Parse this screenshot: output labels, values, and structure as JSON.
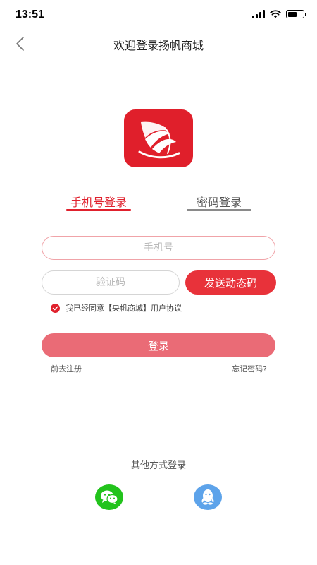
{
  "status_bar": {
    "time": "13:51"
  },
  "header": {
    "title": "欢迎登录扬帆商城"
  },
  "tabs": [
    {
      "label": "手机号登录",
      "active": true
    },
    {
      "label": "密码登录",
      "active": false
    }
  ],
  "form": {
    "phone_placeholder": "手机号",
    "code_placeholder": "验证码",
    "send_code_label": "发送动态码",
    "agreement_text": "我已经同意【央帆商城】用户协议",
    "agreement_checked": true,
    "login_label": "登录"
  },
  "links": {
    "register": "前去注册",
    "forgot": "忘记密码?"
  },
  "other_login": {
    "label": "其他方式登录"
  },
  "colors": {
    "brand_red": "#e0212d",
    "login_button": "#ea6b76",
    "wechat_green": "#22c31c",
    "qq_blue": "#5da3ea"
  },
  "icons": {
    "back": "chevron-left-icon",
    "wechat": "wechat-icon",
    "qq": "qq-icon"
  }
}
